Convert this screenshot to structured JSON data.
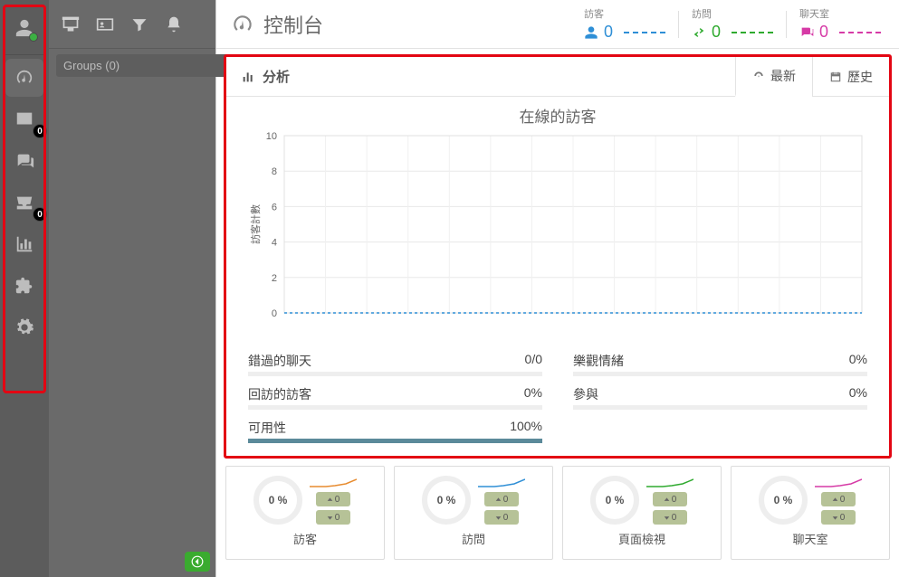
{
  "rail": {
    "badges": {
      "messages": "0",
      "inbox": "0"
    }
  },
  "groups": {
    "search_placeholder": "Groups (0)"
  },
  "header": {
    "title": "控制台",
    "metrics": [
      {
        "label": "訪客",
        "value": "0",
        "color": "#2f8fd6"
      },
      {
        "label": "訪問",
        "value": "0",
        "color": "#2faa2f"
      },
      {
        "label": "聊天室",
        "value": "0",
        "color": "#d63aa6"
      }
    ]
  },
  "analysis": {
    "title": "分析",
    "tabs": {
      "latest": "最新",
      "history": "歷史"
    },
    "chart_title": "在線的訪客",
    "ylabel": "訪客計數",
    "metrics": {
      "missed_chat": {
        "label": "錯過的聊天",
        "value": "0/0",
        "pct": 0
      },
      "returning": {
        "label": "回訪的訪客",
        "value": "0%",
        "pct": 0
      },
      "availability": {
        "label": "可用性",
        "value": "100%",
        "pct": 100
      },
      "sentiment": {
        "label": "樂觀情緒",
        "value": "0%",
        "pct": 0
      },
      "engagement": {
        "label": "參與",
        "value": "0%",
        "pct": 0
      }
    }
  },
  "cards": {
    "gauge_value": "0 %",
    "pill_up": "0",
    "pill_down": "0",
    "items": [
      {
        "label": "訪客"
      },
      {
        "label": "訪問"
      },
      {
        "label": "頁面檢視"
      },
      {
        "label": "聊天室"
      }
    ]
  },
  "chart_data": {
    "type": "line",
    "title": "在線的訪客",
    "xlabel": "",
    "ylabel": "訪客計數",
    "ylim": [
      0,
      10
    ],
    "yticks": [
      0,
      2,
      4,
      6,
      8,
      10
    ],
    "x": [
      0,
      1,
      2,
      3,
      4,
      5,
      6,
      7,
      8,
      9,
      10,
      11,
      12,
      13,
      14
    ],
    "series": [
      {
        "name": "visitors",
        "values": [
          0,
          0,
          0,
          0,
          0,
          0,
          0,
          0,
          0,
          0,
          0,
          0,
          0,
          0,
          0
        ]
      }
    ]
  }
}
